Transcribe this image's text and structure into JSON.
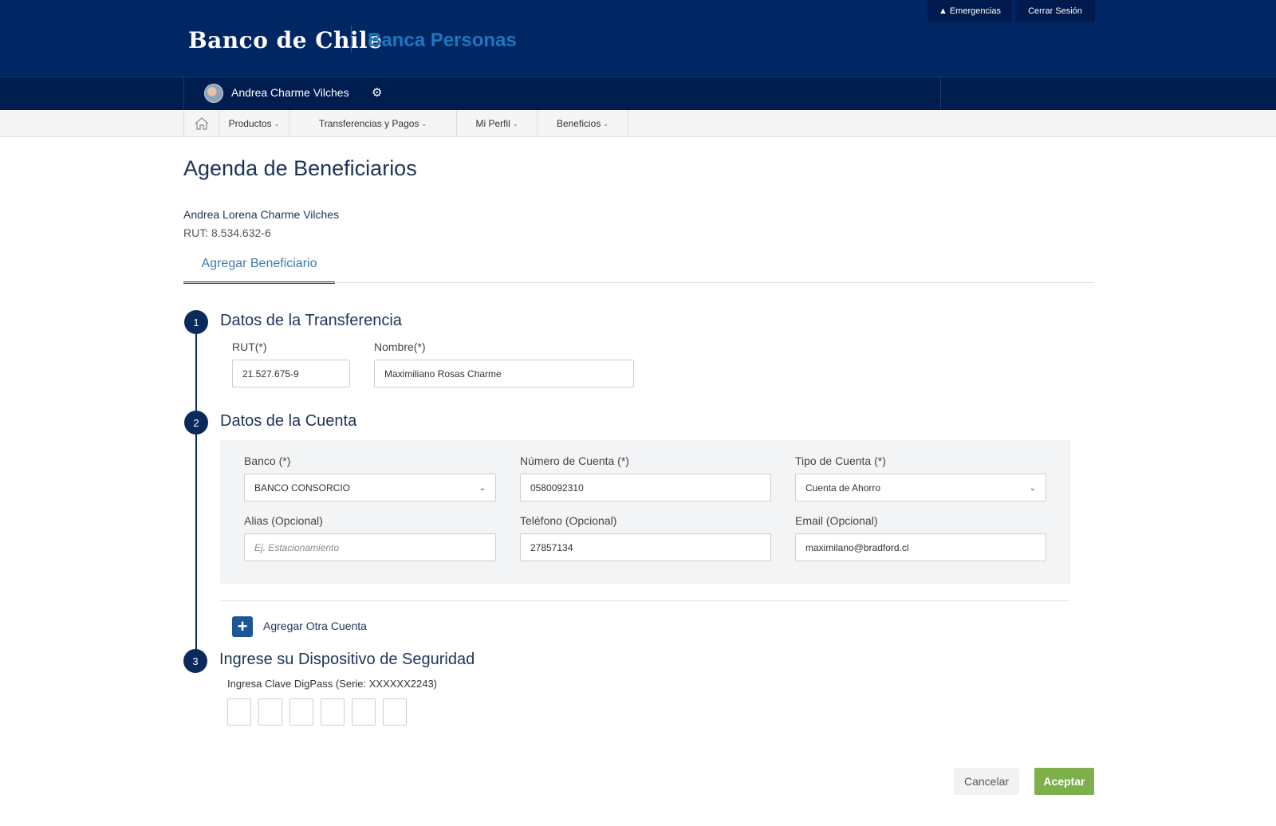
{
  "header": {
    "logo_text": "Banco de Chile",
    "app_title": "Banca Personas",
    "emergency_label": "Emergencias",
    "logout_label": "Cerrar Sesión"
  },
  "user": {
    "name": "Andrea Charme Vilches"
  },
  "nav": {
    "items": [
      {
        "label": "Productos"
      },
      {
        "label": "Transferencias y Pagos"
      },
      {
        "label": "Mi Perfil"
      },
      {
        "label": "Beneficios"
      }
    ]
  },
  "page": {
    "title": "Agenda de Beneficiarios",
    "client_name": "Andrea Lorena Charme Vilches",
    "client_rut": "RUT: 8.534.632-6",
    "tab_label": "Agregar Beneficiario"
  },
  "steps": [
    {
      "number": "1",
      "title": "Datos de la Transferencia"
    },
    {
      "number": "2",
      "title": "Datos de la Cuenta"
    },
    {
      "number": "3",
      "title": "Ingrese su Dispositivo de Seguridad"
    }
  ],
  "transfer": {
    "rut_label": "RUT(*)",
    "rut_value": "21.527.675-9",
    "name_label": "Nombre(*)",
    "name_value": "Maximiliano Rosas Charme"
  },
  "account": {
    "bank_label": "Banco (*)",
    "bank_value": "BANCO CONSORCIO",
    "number_label": "Número de Cuenta (*)",
    "number_value": "0580092310",
    "type_label": "Tipo de Cuenta (*)",
    "type_value": "Cuenta de Ahorro",
    "alias_label": "Alias (Opcional)",
    "alias_placeholder": "Ej. Estacionamiento",
    "phone_label": "Teléfono (Opcional)",
    "phone_value": "27857134",
    "email_label": "Email (Opcional)",
    "email_value": "maximilano@bradford.cl",
    "add_account_label": "Agregar Otra Cuenta"
  },
  "security": {
    "digipass_label": "Ingresa Clave DigPass (Serie: XXXXXX2243)"
  },
  "actions": {
    "cancel_label": "Cancelar",
    "accept_label": "Aceptar"
  }
}
